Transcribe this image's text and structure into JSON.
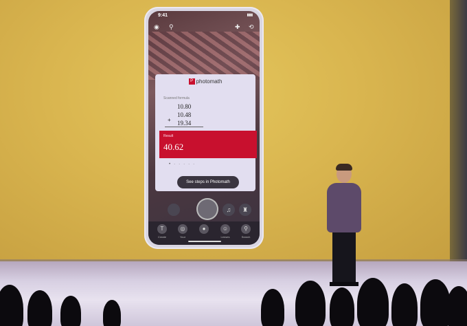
{
  "phone": {
    "status_time": "9:41",
    "status_battery": "▮▮▮",
    "app_name": "photomath",
    "formula_label": "Scanned formula",
    "numbers": [
      "10.80",
      "10.48",
      "19.34"
    ],
    "plus_sign": "+",
    "result_label": "Result",
    "result_value": "40.62",
    "steps_button": "See steps in Photomath",
    "nav_items": [
      {
        "glyph": "T",
        "label": "Create"
      },
      {
        "glyph": "◎",
        "label": "Your"
      },
      {
        "glyph": "●",
        "label": ""
      },
      {
        "glyph": "☺",
        "label": "Lenses"
      },
      {
        "glyph": "⚲",
        "label": "Search"
      }
    ]
  },
  "colors": {
    "accent_red": "#c8102e",
    "backdrop_yellow": "#d9b54f",
    "stage_floor": "#d7cfe2"
  }
}
